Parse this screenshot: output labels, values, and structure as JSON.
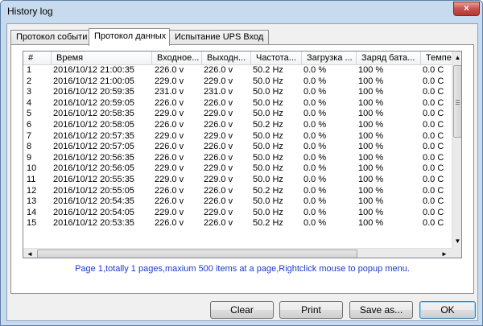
{
  "window": {
    "title": "History log",
    "close_glyph": "×"
  },
  "tabs": [
    {
      "label": "Протокол событи",
      "active": false
    },
    {
      "label": "Протокол данных",
      "active": true
    },
    {
      "label": "Испытание UPS Вход",
      "active": false
    }
  ],
  "table": {
    "columns": [
      "#",
      "Время",
      "Входное...",
      "Выходн...",
      "Частота...",
      "Загрузка ...",
      "Заряд бата...",
      "Темпер"
    ],
    "rows": [
      [
        "1",
        "2016/10/12 21:00:35",
        "226.0 v",
        "226.0 v",
        "50.2 Hz",
        "0.0 %",
        "100 %",
        "0.0 C"
      ],
      [
        "2",
        "2016/10/12 21:00:05",
        "229.0 v",
        "229.0 v",
        "50.0 Hz",
        "0.0 %",
        "100 %",
        "0.0 C"
      ],
      [
        "3",
        "2016/10/12 20:59:35",
        "231.0 v",
        "231.0 v",
        "50.0 Hz",
        "0.0 %",
        "100 %",
        "0.0 C"
      ],
      [
        "4",
        "2016/10/12 20:59:05",
        "226.0 v",
        "226.0 v",
        "50.0 Hz",
        "0.0 %",
        "100 %",
        "0.0 C"
      ],
      [
        "5",
        "2016/10/12 20:58:35",
        "229.0 v",
        "229.0 v",
        "50.0 Hz",
        "0.0 %",
        "100 %",
        "0.0 C"
      ],
      [
        "6",
        "2016/10/12 20:58:05",
        "226.0 v",
        "226.0 v",
        "50.2 Hz",
        "0.0 %",
        "100 %",
        "0.0 C"
      ],
      [
        "7",
        "2016/10/12 20:57:35",
        "229.0 v",
        "229.0 v",
        "50.0 Hz",
        "0.0 %",
        "100 %",
        "0.0 C"
      ],
      [
        "8",
        "2016/10/12 20:57:05",
        "226.0 v",
        "226.0 v",
        "50.0 Hz",
        "0.0 %",
        "100 %",
        "0.0 C"
      ],
      [
        "9",
        "2016/10/12 20:56:35",
        "226.0 v",
        "226.0 v",
        "50.0 Hz",
        "0.0 %",
        "100 %",
        "0.0 C"
      ],
      [
        "10",
        "2016/10/12 20:56:05",
        "229.0 v",
        "229.0 v",
        "50.0 Hz",
        "0.0 %",
        "100 %",
        "0.0 C"
      ],
      [
        "11",
        "2016/10/12 20:55:35",
        "229.0 v",
        "229.0 v",
        "50.0 Hz",
        "0.0 %",
        "100 %",
        "0.0 C"
      ],
      [
        "12",
        "2016/10/12 20:55:05",
        "226.0 v",
        "226.0 v",
        "50.2 Hz",
        "0.0 %",
        "100 %",
        "0.0 C"
      ],
      [
        "13",
        "2016/10/12 20:54:35",
        "226.0 v",
        "226.0 v",
        "50.0 Hz",
        "0.0 %",
        "100 %",
        "0.0 C"
      ],
      [
        "14",
        "2016/10/12 20:54:05",
        "229.0 v",
        "229.0 v",
        "50.0 Hz",
        "0.0 %",
        "100 %",
        "0.0 C"
      ],
      [
        "15",
        "2016/10/12 20:53:35",
        "226.0 v",
        "226.0 v",
        "50.2 Hz",
        "0.0 %",
        "100 %",
        "0.0 C"
      ]
    ]
  },
  "scroll_arrows": {
    "up": "▲",
    "down": "▼",
    "left": "◄",
    "right": "►"
  },
  "status_text": "Page 1,totally 1 pages,maxium  500  items at a page,Rightclick mouse to popup menu.",
  "buttons": {
    "clear": "Clear",
    "print": "Print",
    "save_as": "Save as...",
    "ok": "OK"
  },
  "colors": {
    "status_text": "#1a3cc8",
    "close_button": "#c75050",
    "frame": "#c8dbee"
  }
}
